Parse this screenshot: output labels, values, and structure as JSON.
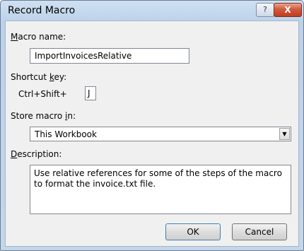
{
  "window": {
    "title": "Record Macro",
    "help_glyph": "?",
    "close_glyph": "X"
  },
  "macro_name": {
    "label_accel": "M",
    "label_rest": "acro name:",
    "value": "ImportInvoicesRelative"
  },
  "shortcut_key": {
    "label_pre": "Shortcut ",
    "label_accel": "k",
    "label_post": "ey:",
    "prefix": "Ctrl+Shift+",
    "value": "J"
  },
  "store_macro_in": {
    "label_pre": "Store macro ",
    "label_accel": "i",
    "label_post": "n:",
    "selected": "This Workbook"
  },
  "description": {
    "label_accel": "D",
    "label_rest": "escription:",
    "value": "Use relative references for some of the steps of the macro to format the invoice.txt file."
  },
  "buttons": {
    "ok": "OK",
    "cancel": "Cancel"
  },
  "icons": {
    "help": "help-icon",
    "close": "close-icon",
    "dropdown": "chevron-down-icon"
  }
}
